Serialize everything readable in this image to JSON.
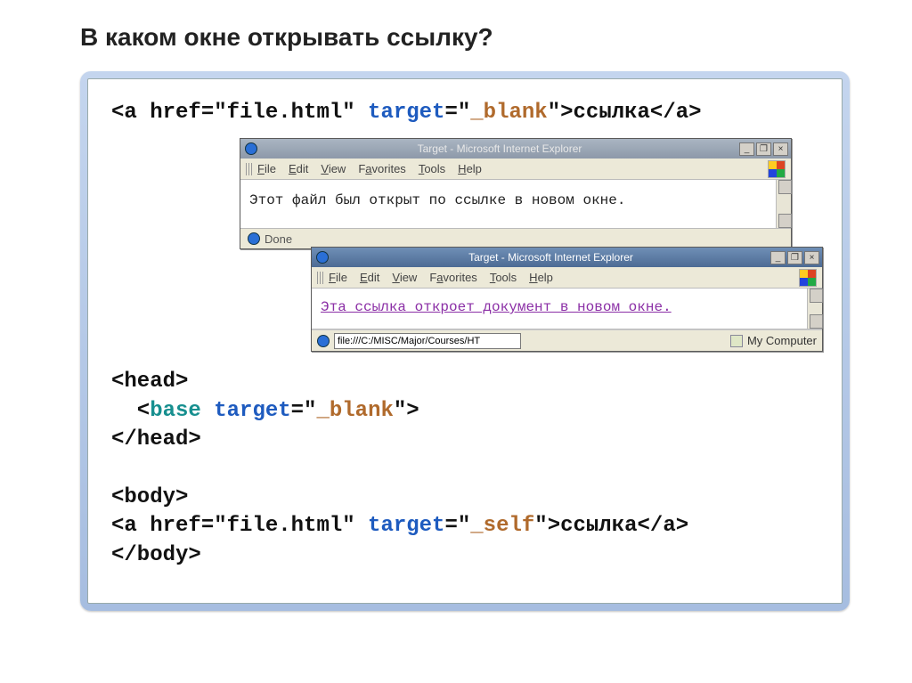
{
  "title": "В каком окне открывать ссылку?",
  "code1": {
    "t1": "<a href=\"file.html\" ",
    "attr": "target",
    "eq": "=\"",
    "val": "_blank",
    "t2": "\">ссылка</a>"
  },
  "code2": {
    "l1": "<head>",
    "l2a": "  <",
    "basekw": "base",
    "sp": " ",
    "attr": "target",
    "eq": "=\"",
    "val": "_blank",
    "l2b": "\">",
    "l3": "</head>",
    "blank": "",
    "l4": "<body>",
    "l5a": "<a href=\"file.html\" ",
    "attr2": "target",
    "eq2": "=\"",
    "val2": "_self",
    "l5b": "\">ссылка</a>",
    "l6": "</body>"
  },
  "win1": {
    "caption": "Target - Microsoft Internet Explorer",
    "menu": [
      "File",
      "Edit",
      "View",
      "Favorites",
      "Tools",
      "Help"
    ],
    "content": "Этот файл был открыт по ссылке в новом окне.",
    "status": "Done"
  },
  "win2": {
    "caption": "Target - Microsoft Internet Explorer",
    "menu": [
      "File",
      "Edit",
      "View",
      "Favorites",
      "Tools",
      "Help"
    ],
    "content": "Эта ссылка откроет документ в новом окне.",
    "url": "file:///C:/MISC/Major/Courses/HT",
    "zone": "My Computer"
  }
}
